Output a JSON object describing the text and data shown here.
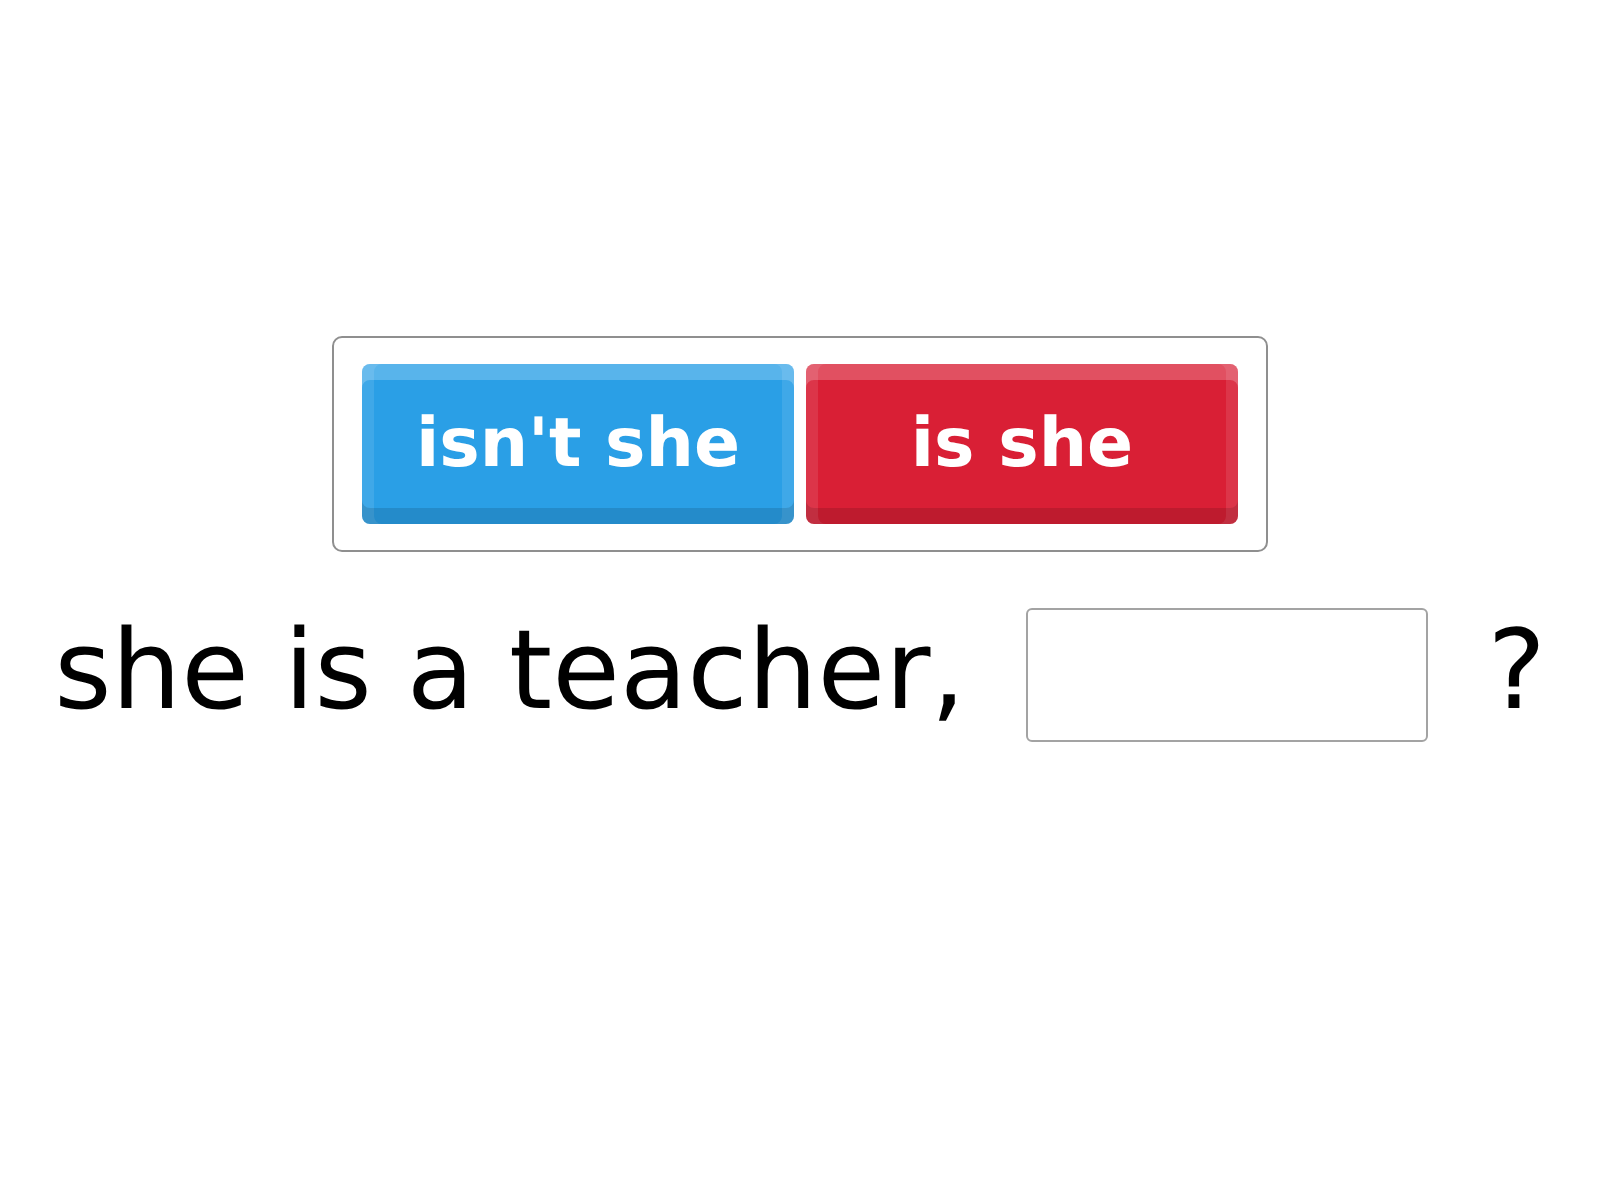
{
  "options": [
    {
      "label": "isn't she",
      "color": "#2a9fe6"
    },
    {
      "label": "is she",
      "color": "#d91f35"
    }
  ],
  "sentence": [
    {
      "kind": "text",
      "text": "she is a teacher,"
    },
    {
      "kind": "blank"
    },
    {
      "kind": "text",
      "text": "?"
    }
  ]
}
